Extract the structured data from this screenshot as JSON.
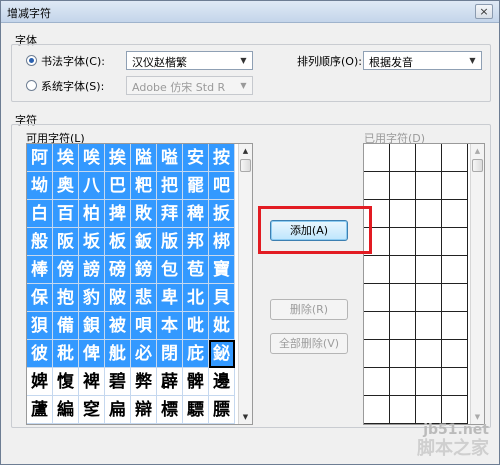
{
  "dialog": {
    "title": "增减字符",
    "close_glyph": "×"
  },
  "font_group": {
    "label": "字体",
    "calligraphy_radio": "书法字体(C):",
    "calligraphy_value": "汉仪赵楷繁",
    "system_radio": "系统字体(S):",
    "system_value": "Adobe 仿宋 Std R",
    "sort_label": "排列顺序(O):",
    "sort_value": "根据发音",
    "selected_radio": "calligraphy"
  },
  "chars_group": {
    "label": "字符",
    "available_label": "可用字符(L)",
    "used_label": "已用字符(D)",
    "available_rows": [
      [
        "阿",
        "埃",
        "唉",
        "挨",
        "隘",
        "嗌",
        "安",
        "按"
      ],
      [
        "坳",
        "奥",
        "八",
        "巴",
        "粑",
        "把",
        "罷",
        "吧"
      ],
      [
        "白",
        "百",
        "柏",
        "捭",
        "敗",
        "拜",
        "稗",
        "扳"
      ],
      [
        "般",
        "阪",
        "坂",
        "板",
        "鈑",
        "版",
        "邦",
        "梆"
      ],
      [
        "棒",
        "傍",
        "謗",
        "磅",
        "鎊",
        "包",
        "苞",
        "寶"
      ],
      [
        "保",
        "抱",
        "豹",
        "陂",
        "悲",
        "卑",
        "北",
        "貝"
      ],
      [
        "狽",
        "備",
        "鋇",
        "被",
        "唄",
        "本",
        "吡",
        "妣"
      ],
      [
        "彼",
        "秕",
        "俾",
        "舭",
        "必",
        "閉",
        "庇",
        "鉍"
      ],
      [
        "婢",
        "愎",
        "裨",
        "碧",
        "弊",
        "薜",
        "髀",
        "邊"
      ],
      [
        "蘆",
        "編",
        "窆",
        "扁",
        "辯",
        "標",
        "驃",
        "膘"
      ]
    ],
    "selected_rows": 8,
    "focused_cell": [
      7,
      7
    ]
  },
  "buttons": {
    "add": "添加(A)",
    "delete": "删除(R)",
    "delete_all": "全部删除(V)"
  },
  "scroll": {
    "up": "▲",
    "down": "▼"
  },
  "combo_arrow": "▼",
  "watermark": {
    "line1": "jb51.net",
    "line2": "脚本之家"
  }
}
